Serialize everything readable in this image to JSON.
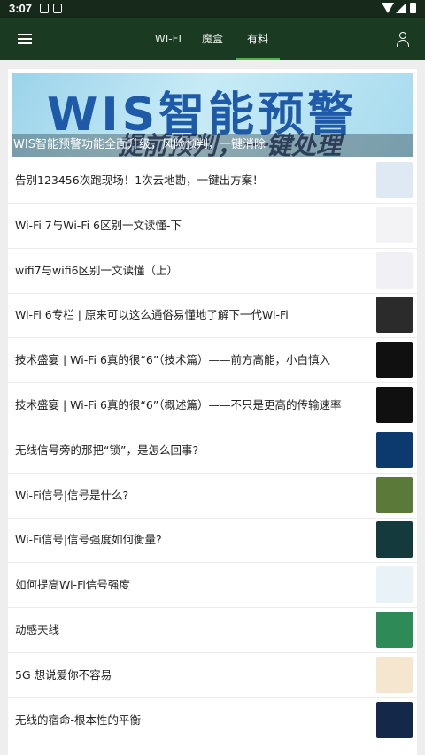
{
  "status_bar": {
    "time": "3:07"
  },
  "header": {
    "tabs": [
      {
        "label": "WI-FI"
      },
      {
        "label": "魔盒"
      },
      {
        "label": "有料",
        "active": true
      }
    ],
    "icons": {
      "menu": "menu-icon",
      "user": "user-icon"
    }
  },
  "banner": {
    "headline": "WIS智能预警",
    "subline": "提前预判，一键处理",
    "caption": "WIS智能预警功能全面升级，风险预判，一键消除"
  },
  "articles": [
    {
      "title": "告别123456次跑现场！1次云地勘，一键出方案！",
      "thumb_color": "#dfe9f4"
    },
    {
      "title": "Wi-Fi 7与Wi-Fi 6区别一文读懂-下",
      "thumb_color": "#f3f3f6"
    },
    {
      "title": "wifi7与wifi6区别一文读懂（上）",
      "thumb_color": "#f1f1f5"
    },
    {
      "title": "Wi-Fi 6专栏 | 原来可以这么通俗易懂地了解下一代Wi-Fi",
      "thumb_color": "#2b2b2b"
    },
    {
      "title": "技术盛宴 | Wi-Fi 6真的很“6”（技术篇）——前方高能，小白慎入",
      "thumb_color": "#101010"
    },
    {
      "title": "技术盛宴 | Wi-Fi 6真的很“6”（概述篇）——不只是更高的传输速率",
      "thumb_color": "#101010"
    },
    {
      "title": "无线信号旁的那把“锁”，是怎么回事?",
      "thumb_color": "#0d3a6e"
    },
    {
      "title": "Wi-Fi信号|信号是什么?",
      "thumb_color": "#5b7a3a"
    },
    {
      "title": "Wi-Fi信号|信号强度如何衡量?",
      "thumb_color": "#153a3e"
    },
    {
      "title": "如何提高Wi-Fi信号强度",
      "thumb_color": "#e9f2f6"
    },
    {
      "title": "动感天线",
      "thumb_color": "#2e8b57"
    },
    {
      "title": "5G 想说爱你不容易",
      "thumb_color": "#f5e6cf"
    },
    {
      "title": "无线的宿命-根本性的平衡",
      "thumb_color": "#14284a"
    }
  ]
}
